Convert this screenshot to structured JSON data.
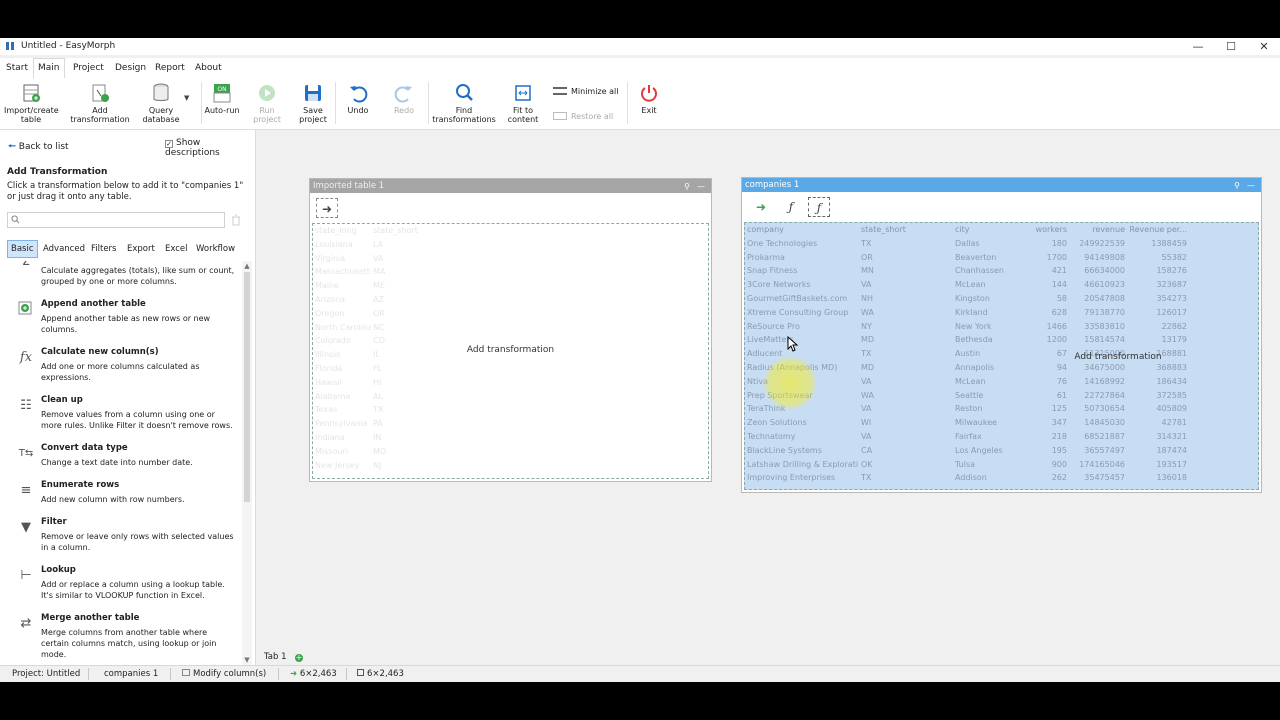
{
  "window": {
    "title": "Untitled - EasyMorph"
  },
  "menu": [
    "Start",
    "Main",
    "Project",
    "Design",
    "Report",
    "About"
  ],
  "ribbon": {
    "import_create": "Import/create table",
    "add_transformation": "Add transformation",
    "query_database": "Query database",
    "auto_run": "Auto-run",
    "run_project": "Run project",
    "save_project": "Save project",
    "undo": "Undo",
    "redo": "Redo",
    "find_transformations": "Find transformations",
    "fit_to_content": "Fit to content",
    "minimize_all": "Minimize all",
    "restore_all": "Restore all",
    "exit": "Exit",
    "auto_run_badge": "ON"
  },
  "left_panel": {
    "back": "Back to list",
    "show_descriptions": "Show descriptions",
    "heading": "Add Transformation",
    "hint": "Click a transformation below to add it to \"companies 1\" or just drag it onto any table.",
    "search_placeholder": "",
    "tabs": [
      "Basic",
      "Advanced",
      "Filters",
      "Export",
      "Excel",
      "Workflow"
    ],
    "items": [
      {
        "name": "",
        "desc": "Calculate aggregates (totals), like sum or count, grouped by one or more columns.",
        "icon": "aggregate-icon"
      },
      {
        "name": "Append another table",
        "desc": "Append another table as new rows or new columns.",
        "icon": "append-icon"
      },
      {
        "name": "Calculate new column(s)",
        "desc": "Add one or more columns calculated as expressions.",
        "icon": "fx-icon"
      },
      {
        "name": "Clean up",
        "desc": "Remove values from a column using one or more rules. Unlike Filter it doesn't remove rows.",
        "icon": "cleanup-icon"
      },
      {
        "name": "Convert data type",
        "desc": "Change a text date into number date.",
        "icon": "convert-icon"
      },
      {
        "name": "Enumerate rows",
        "desc": "Add new column with row numbers.",
        "icon": "enumerate-icon"
      },
      {
        "name": "Filter",
        "desc": "Remove or leave only rows with selected values in a column.",
        "icon": "filter-icon"
      },
      {
        "name": "Lookup",
        "desc": "Add or replace a column using a lookup table. It's similar to VLOOKUP function in Excel.",
        "icon": "lookup-icon"
      },
      {
        "name": "Merge another table",
        "desc": "Merge columns from another table where certain columns match, using lookup or join mode.",
        "icon": "merge-icon"
      }
    ]
  },
  "tables": {
    "imported": {
      "title": "Imported table 1",
      "add_label": "Add transformation",
      "columns": [
        "state_long",
        "state_short"
      ],
      "rows": [
        [
          "Louisiana",
          "LA"
        ],
        [
          "Virginia",
          "VA"
        ],
        [
          "Massachusetts",
          "MA"
        ],
        [
          "Maine",
          "ME"
        ],
        [
          "Arizona",
          "AZ"
        ],
        [
          "Oregon",
          "OR"
        ],
        [
          "North Carolina",
          "NC"
        ],
        [
          "Colorado",
          "CO"
        ],
        [
          "Illinois",
          "IL"
        ],
        [
          "Florida",
          "FL"
        ],
        [
          "Hawaii",
          "HI"
        ],
        [
          "Alabama",
          "AL"
        ],
        [
          "Texas",
          "TX"
        ],
        [
          "Pennsylvania",
          "PA"
        ],
        [
          "Indiana",
          "IN"
        ],
        [
          "Missouri",
          "MO"
        ],
        [
          "New Jersey",
          "NJ"
        ]
      ]
    },
    "companies": {
      "title": "companies 1",
      "add_label": "Add transformation",
      "columns": [
        "company",
        "state_short",
        "city",
        "workers",
        "revenue",
        "Revenue per..."
      ],
      "rows": [
        [
          "One Technologies",
          "TX",
          "Dallas",
          "180",
          "249922539",
          "1388459"
        ],
        [
          "Prokarma",
          "OR",
          "Beaverton",
          "1700",
          "94149808",
          "55382"
        ],
        [
          "Snap Fitness",
          "MN",
          "Chanhassen",
          "421",
          "66634000",
          "158276"
        ],
        [
          "3Core Networks",
          "VA",
          "McLean",
          "144",
          "46610923",
          "323687"
        ],
        [
          "GourmetGiftBaskets.com",
          "NH",
          "Kingston",
          "58",
          "20547808",
          "354273"
        ],
        [
          "Xtreme Consulting Group",
          "WA",
          "Kirkland",
          "628",
          "79138770",
          "126017"
        ],
        [
          "ReSource Pro",
          "NY",
          "New York",
          "1466",
          "33583810",
          "22862"
        ],
        [
          "LiveMatters",
          "MD",
          "Bethesda",
          "1200",
          "15814574",
          "13179"
        ],
        [
          "Adlucent",
          "TX",
          "Austin",
          "67",
          "11315000",
          "168881"
        ],
        [
          "Radius (Annapolis MD)",
          "MD",
          "Annapolis",
          "94",
          "34675000",
          "368883"
        ],
        [
          "Ntiva",
          "VA",
          "McLean",
          "76",
          "14168992",
          "186434"
        ],
        [
          "Prep Sportswear",
          "WA",
          "Seattle",
          "61",
          "22727864",
          "372585"
        ],
        [
          "TeraThink",
          "VA",
          "Reston",
          "125",
          "50730654",
          "405809"
        ],
        [
          "Zeon Solutions",
          "WI",
          "Milwaukee",
          "347",
          "14845030",
          "42781"
        ],
        [
          "Technatomy",
          "VA",
          "Fairfax",
          "218",
          "68521887",
          "314321"
        ],
        [
          "BlackLine Systems",
          "CA",
          "Los Angeles",
          "195",
          "36557497",
          "187474"
        ],
        [
          "Latshaw Drilling & Explorati...",
          "OK",
          "Tulsa",
          "900",
          "174165046",
          "193517"
        ],
        [
          "Improving Enterprises",
          "TX",
          "Addison",
          "262",
          "35475457",
          "136018"
        ]
      ]
    }
  },
  "tabbar": {
    "tab": "Tab 1"
  },
  "status": {
    "project": "Project: Untitled",
    "table": "companies 1",
    "action": "Modify column(s)",
    "dims1": "6×2,463",
    "dims2": "6×2,463"
  }
}
